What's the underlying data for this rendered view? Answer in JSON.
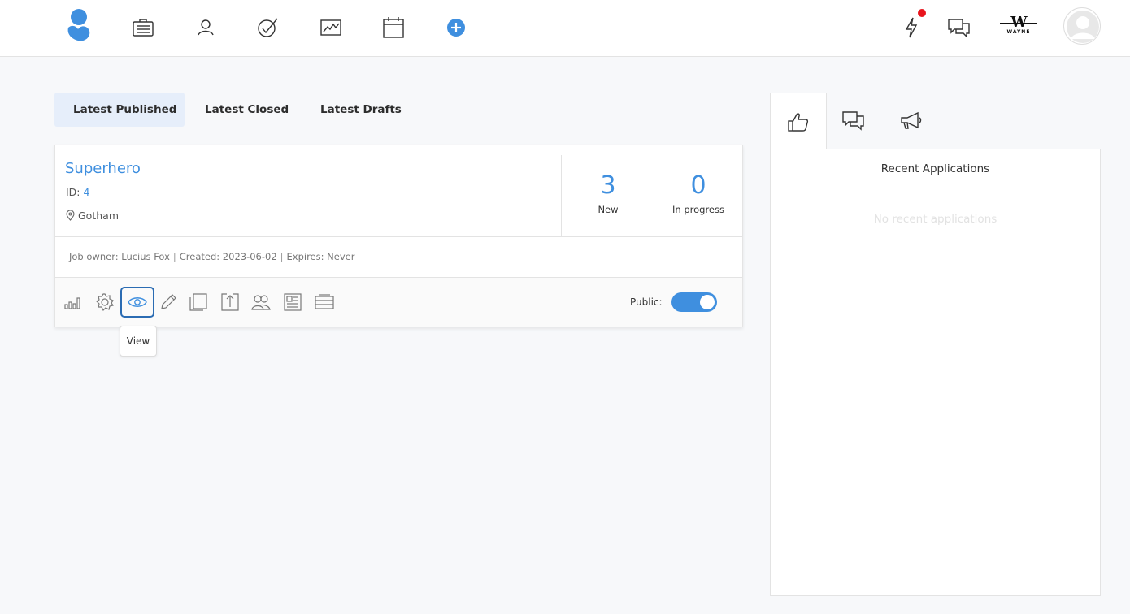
{
  "nav": {
    "items": [
      "jobs-icon",
      "candidates-icon",
      "tasks-icon",
      "reports-icon",
      "calendar-icon",
      "add-icon"
    ],
    "brand_mark": "W",
    "brand_name": "WAYNE",
    "accent": "#3f8fdf",
    "notification_color": "#e8141c"
  },
  "tabs": [
    {
      "label": "Latest Published",
      "active": true
    },
    {
      "label": "Latest Closed",
      "active": false
    },
    {
      "label": "Latest Drafts",
      "active": false
    }
  ],
  "job": {
    "title": "Superhero",
    "id_label": "ID:",
    "id_value": "4",
    "location": "Gotham",
    "stats": [
      {
        "value": "3",
        "label": "New"
      },
      {
        "value": "0",
        "label": "In progress"
      }
    ],
    "meta": {
      "owner": "Job owner: Lucius Fox",
      "created": "Created: 2023-06-02",
      "expires": "Expires: Never"
    },
    "actions": [
      "stats-icon",
      "settings-icon",
      "view-icon",
      "edit-icon",
      "copy-icon",
      "export-icon",
      "team-icon",
      "report-icon",
      "archive-icon"
    ],
    "public_label": "Public:",
    "public_on": true,
    "tooltip": "View"
  },
  "right_panel": {
    "tabs": [
      "thumbs-up-icon",
      "chat-icon",
      "megaphone-icon"
    ],
    "title": "Recent Applications",
    "empty_text": "No recent applications"
  }
}
